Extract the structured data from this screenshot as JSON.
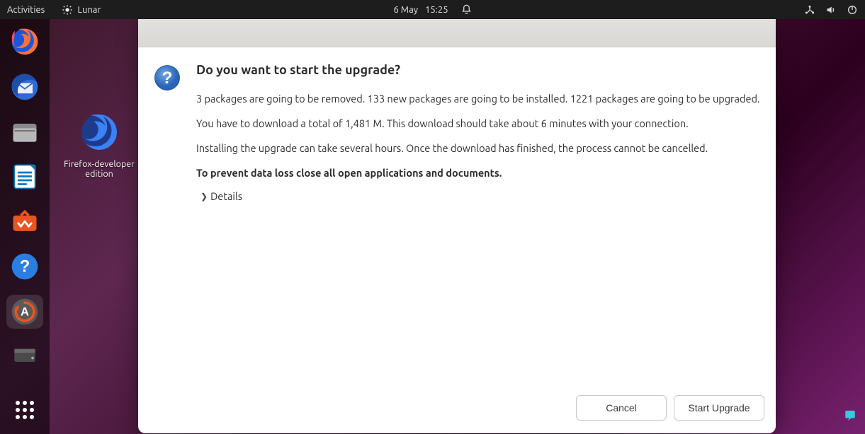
{
  "topbar": {
    "activities": "Activities",
    "app_name": "Lunar",
    "date": "6 May",
    "time": "15:25"
  },
  "dock": {
    "items": [
      {
        "name": "firefox-icon",
        "active": false
      },
      {
        "name": "thunderbird-icon",
        "active": false
      },
      {
        "name": "files-icon",
        "active": false
      },
      {
        "name": "libreoffice-writer-icon",
        "active": false
      },
      {
        "name": "ubuntu-software-icon",
        "active": false
      },
      {
        "name": "help-icon",
        "active": false
      },
      {
        "name": "software-updater-icon",
        "active": true
      }
    ],
    "apps_grid": "show-apps"
  },
  "desktop": {
    "icon_label": "Firefox-developer\nedition"
  },
  "dialog": {
    "heading": "Do you want to start the upgrade?",
    "line1": "3 packages are going to be removed. 133 new packages are going to be installed. 1221 packages are going to be upgraded.",
    "line2": "You have to download a total of 1,481 M. This download should take about 6 minutes with your connection.",
    "line3": "Installing the upgrade can take several hours. Once the download has finished, the process cannot be cancelled.",
    "warning": "To prevent data loss close all open applications and documents.",
    "details_label": "Details",
    "cancel_label": "Cancel",
    "upgrade_label": "Start Upgrade"
  }
}
